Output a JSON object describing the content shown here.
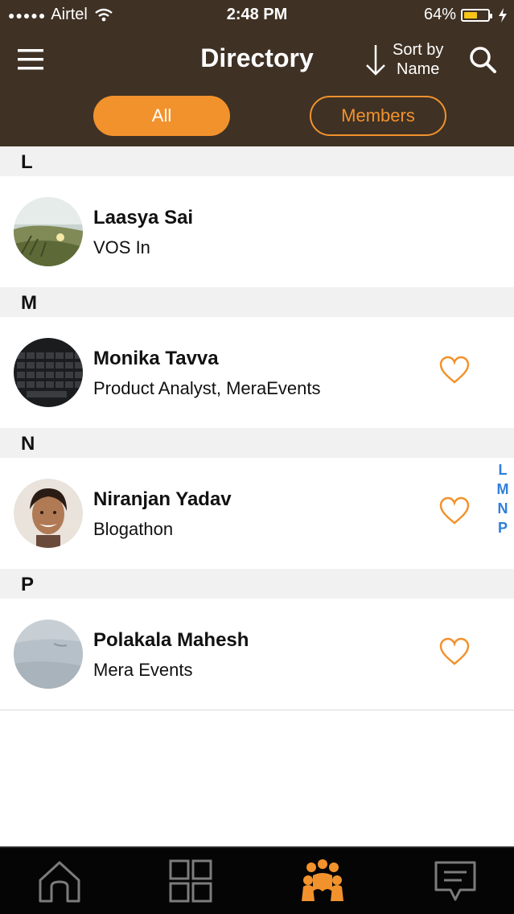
{
  "status_bar": {
    "signal_dots": "●●●●●",
    "carrier": "Airtel",
    "time": "2:48 PM",
    "battery_percent": "64%",
    "battery_level": 0.64
  },
  "nav": {
    "title": "Directory",
    "sort_line1": "Sort by",
    "sort_line2": "Name"
  },
  "filters": {
    "all_label": "All",
    "members_label": "Members"
  },
  "sections": [
    {
      "letter": "L",
      "entries": [
        {
          "name": "Laasya Sai",
          "subtitle": "VOS In",
          "favorite_icon": false
        }
      ]
    },
    {
      "letter": "M",
      "entries": [
        {
          "name": "Monika Tavva",
          "subtitle": "Product Analyst, MeraEvents",
          "favorite_icon": true
        }
      ]
    },
    {
      "letter": "N",
      "entries": [
        {
          "name": "Niranjan Yadav",
          "subtitle": "Blogathon",
          "favorite_icon": true
        }
      ]
    },
    {
      "letter": "P",
      "entries": [
        {
          "name": "Polakala Mahesh",
          "subtitle": "Mera Events",
          "favorite_icon": true
        }
      ]
    }
  ],
  "index_letters": [
    "L",
    "M",
    "N",
    "P"
  ],
  "colors": {
    "header_bg": "#3f3124",
    "accent": "#f2922d",
    "index_blue": "#2f7fd8"
  },
  "tabs": [
    {
      "icon": "home-icon",
      "active": false
    },
    {
      "icon": "grid-icon",
      "active": false
    },
    {
      "icon": "people-icon",
      "active": true
    },
    {
      "icon": "chat-icon",
      "active": false
    }
  ]
}
